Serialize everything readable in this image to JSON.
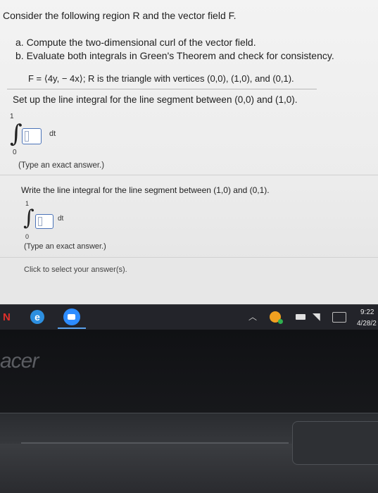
{
  "question": {
    "intro": "Consider the following region R and the vector field F.",
    "part_a": "a. Compute the two-dimensional curl of the vector field.",
    "part_b": "b. Evaluate both integrals in Green's Theorem and check for consistency.",
    "field_statement": "F = ⟨4y, − 4x⟩; R is the triangle with vertices (0,0), (1,0), and (0,1).",
    "setup_prompt": "Set up the line integral for the line segment between (0,0) and (1,0).",
    "integral_1": {
      "upper": "1",
      "lower": "0",
      "differential": "dt"
    },
    "hint_1": "(Type an exact answer.)",
    "write_prompt": "Write the line integral for the line segment between (1,0) and (0,1).",
    "integral_2": {
      "upper": "1",
      "lower": "0",
      "differential": "dt"
    },
    "hint_2": "(Type an exact answer.)",
    "click_prompt": "Click to select your answer(s)."
  },
  "taskbar": {
    "start_glyph": "N",
    "edge_glyph": "e",
    "clock_time": "9:22",
    "clock_date": "4/28/2",
    "icons": [
      "start-icon",
      "edge-icon",
      "zoom-app-icon",
      "chevron-up-icon",
      "tray-app-icon",
      "battery-icon",
      "wifi-icon",
      "keyboard-icon"
    ]
  },
  "device": {
    "brand": "acer"
  },
  "colors": {
    "input_border": "#4b73b8",
    "taskbar": "#23242a",
    "accent_blue": "#2d8cff"
  }
}
